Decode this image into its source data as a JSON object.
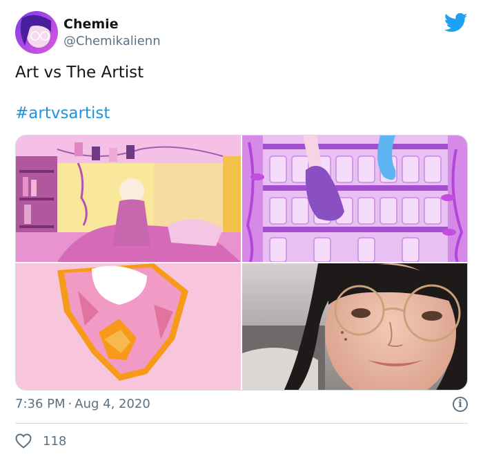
{
  "tweet": {
    "author": {
      "display_name": "Chemie",
      "handle": "@Chemikalienn",
      "avatar_icon": "avatar-image"
    },
    "brand_icon": "twitter-bird-icon",
    "brand_color": "#1da1f2",
    "text": "Art vs The Artist",
    "hashtag": "#artvsartist",
    "hashtag_color": "#1b95e0",
    "media": [
      {
        "icon": "artwork-bedroom-image"
      },
      {
        "icon": "artwork-shelf-image"
      },
      {
        "icon": "artwork-heart-image"
      },
      {
        "icon": "artist-selfie-image"
      }
    ],
    "time": "7:36 PM",
    "separator": "·",
    "date": "Aug 4, 2020",
    "info_icon": "info-icon",
    "info_glyph": "i",
    "likes": {
      "icon": "heart-icon",
      "count": "118"
    },
    "muted_color": "#5b7083"
  }
}
